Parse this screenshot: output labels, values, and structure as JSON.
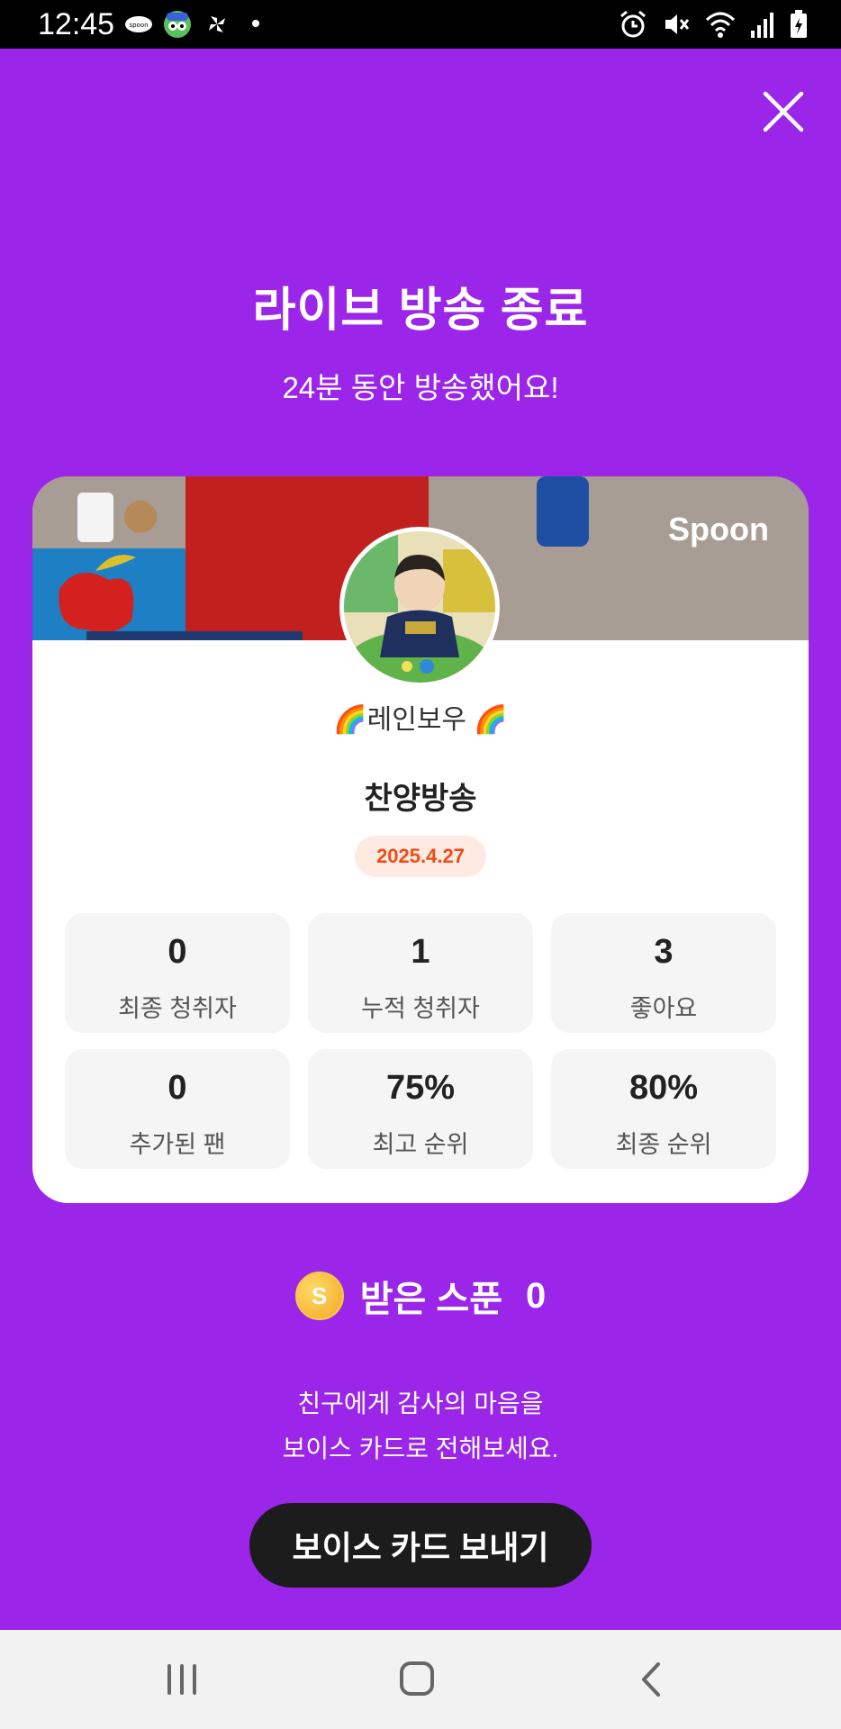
{
  "status_bar": {
    "time": "12:45",
    "left_icons": [
      "spoon-app-icon",
      "character-app-icon",
      "pinwheel-icon",
      "dot-icon"
    ],
    "right_icons": [
      "alarm-icon",
      "mute-icon",
      "wifi-icon",
      "signal-icon",
      "battery-icon"
    ]
  },
  "header": {
    "title": "라이브 방송 종료",
    "subtitle": "24분 동안 방송했어요!"
  },
  "card": {
    "brand": "Spoon",
    "nickname": "🌈레인보우 🌈",
    "room_title": "찬양방송",
    "date": "2025.4.27",
    "stats": [
      {
        "value": "0",
        "label": "최종 청취자"
      },
      {
        "value": "1",
        "label": "누적 청취자"
      },
      {
        "value": "3",
        "label": "좋아요"
      },
      {
        "value": "0",
        "label": "추가된 팬"
      },
      {
        "value": "75%",
        "label": "최고 순위"
      },
      {
        "value": "80%",
        "label": "최종 순위"
      }
    ]
  },
  "spoon": {
    "coin_letter": "S",
    "label": "받은 스푼",
    "count": "0"
  },
  "message": {
    "line1": "친구에게 감사의 마음을",
    "line2": "보이스 카드로 전해보세요."
  },
  "voice_card_button": "보이스 카드 보내기",
  "nav": [
    "recent-apps",
    "home",
    "back"
  ],
  "colors": {
    "background": "#9B25E8",
    "date_badge_bg": "#FDEBE3",
    "date_badge_text": "#F04B16",
    "button_bg": "#1C1C1C"
  }
}
